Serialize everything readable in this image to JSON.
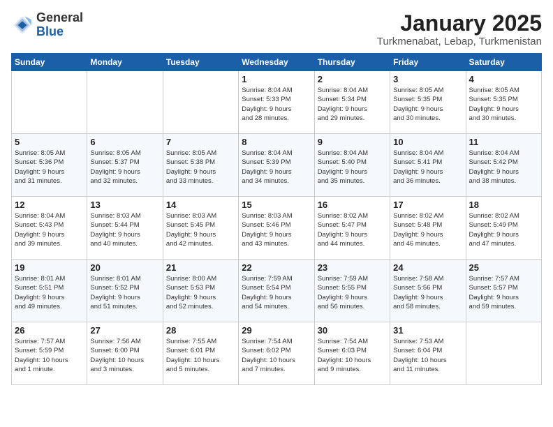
{
  "header": {
    "logo_general": "General",
    "logo_blue": "Blue",
    "title": "January 2025",
    "subtitle": "Turkmenabat, Lebap, Turkmenistan"
  },
  "days_of_week": [
    "Sunday",
    "Monday",
    "Tuesday",
    "Wednesday",
    "Thursday",
    "Friday",
    "Saturday"
  ],
  "weeks": [
    [
      {
        "day": "",
        "info": ""
      },
      {
        "day": "",
        "info": ""
      },
      {
        "day": "",
        "info": ""
      },
      {
        "day": "1",
        "info": "Sunrise: 8:04 AM\nSunset: 5:33 PM\nDaylight: 9 hours\nand 28 minutes."
      },
      {
        "day": "2",
        "info": "Sunrise: 8:04 AM\nSunset: 5:34 PM\nDaylight: 9 hours\nand 29 minutes."
      },
      {
        "day": "3",
        "info": "Sunrise: 8:05 AM\nSunset: 5:35 PM\nDaylight: 9 hours\nand 30 minutes."
      },
      {
        "day": "4",
        "info": "Sunrise: 8:05 AM\nSunset: 5:35 PM\nDaylight: 9 hours\nand 30 minutes."
      }
    ],
    [
      {
        "day": "5",
        "info": "Sunrise: 8:05 AM\nSunset: 5:36 PM\nDaylight: 9 hours\nand 31 minutes."
      },
      {
        "day": "6",
        "info": "Sunrise: 8:05 AM\nSunset: 5:37 PM\nDaylight: 9 hours\nand 32 minutes."
      },
      {
        "day": "7",
        "info": "Sunrise: 8:05 AM\nSunset: 5:38 PM\nDaylight: 9 hours\nand 33 minutes."
      },
      {
        "day": "8",
        "info": "Sunrise: 8:04 AM\nSunset: 5:39 PM\nDaylight: 9 hours\nand 34 minutes."
      },
      {
        "day": "9",
        "info": "Sunrise: 8:04 AM\nSunset: 5:40 PM\nDaylight: 9 hours\nand 35 minutes."
      },
      {
        "day": "10",
        "info": "Sunrise: 8:04 AM\nSunset: 5:41 PM\nDaylight: 9 hours\nand 36 minutes."
      },
      {
        "day": "11",
        "info": "Sunrise: 8:04 AM\nSunset: 5:42 PM\nDaylight: 9 hours\nand 38 minutes."
      }
    ],
    [
      {
        "day": "12",
        "info": "Sunrise: 8:04 AM\nSunset: 5:43 PM\nDaylight: 9 hours\nand 39 minutes."
      },
      {
        "day": "13",
        "info": "Sunrise: 8:03 AM\nSunset: 5:44 PM\nDaylight: 9 hours\nand 40 minutes."
      },
      {
        "day": "14",
        "info": "Sunrise: 8:03 AM\nSunset: 5:45 PM\nDaylight: 9 hours\nand 42 minutes."
      },
      {
        "day": "15",
        "info": "Sunrise: 8:03 AM\nSunset: 5:46 PM\nDaylight: 9 hours\nand 43 minutes."
      },
      {
        "day": "16",
        "info": "Sunrise: 8:02 AM\nSunset: 5:47 PM\nDaylight: 9 hours\nand 44 minutes."
      },
      {
        "day": "17",
        "info": "Sunrise: 8:02 AM\nSunset: 5:48 PM\nDaylight: 9 hours\nand 46 minutes."
      },
      {
        "day": "18",
        "info": "Sunrise: 8:02 AM\nSunset: 5:49 PM\nDaylight: 9 hours\nand 47 minutes."
      }
    ],
    [
      {
        "day": "19",
        "info": "Sunrise: 8:01 AM\nSunset: 5:51 PM\nDaylight: 9 hours\nand 49 minutes."
      },
      {
        "day": "20",
        "info": "Sunrise: 8:01 AM\nSunset: 5:52 PM\nDaylight: 9 hours\nand 51 minutes."
      },
      {
        "day": "21",
        "info": "Sunrise: 8:00 AM\nSunset: 5:53 PM\nDaylight: 9 hours\nand 52 minutes."
      },
      {
        "day": "22",
        "info": "Sunrise: 7:59 AM\nSunset: 5:54 PM\nDaylight: 9 hours\nand 54 minutes."
      },
      {
        "day": "23",
        "info": "Sunrise: 7:59 AM\nSunset: 5:55 PM\nDaylight: 9 hours\nand 56 minutes."
      },
      {
        "day": "24",
        "info": "Sunrise: 7:58 AM\nSunset: 5:56 PM\nDaylight: 9 hours\nand 58 minutes."
      },
      {
        "day": "25",
        "info": "Sunrise: 7:57 AM\nSunset: 5:57 PM\nDaylight: 9 hours\nand 59 minutes."
      }
    ],
    [
      {
        "day": "26",
        "info": "Sunrise: 7:57 AM\nSunset: 5:59 PM\nDaylight: 10 hours\nand 1 minute."
      },
      {
        "day": "27",
        "info": "Sunrise: 7:56 AM\nSunset: 6:00 PM\nDaylight: 10 hours\nand 3 minutes."
      },
      {
        "day": "28",
        "info": "Sunrise: 7:55 AM\nSunset: 6:01 PM\nDaylight: 10 hours\nand 5 minutes."
      },
      {
        "day": "29",
        "info": "Sunrise: 7:54 AM\nSunset: 6:02 PM\nDaylight: 10 hours\nand 7 minutes."
      },
      {
        "day": "30",
        "info": "Sunrise: 7:54 AM\nSunset: 6:03 PM\nDaylight: 10 hours\nand 9 minutes."
      },
      {
        "day": "31",
        "info": "Sunrise: 7:53 AM\nSunset: 6:04 PM\nDaylight: 10 hours\nand 11 minutes."
      },
      {
        "day": "",
        "info": ""
      }
    ]
  ]
}
